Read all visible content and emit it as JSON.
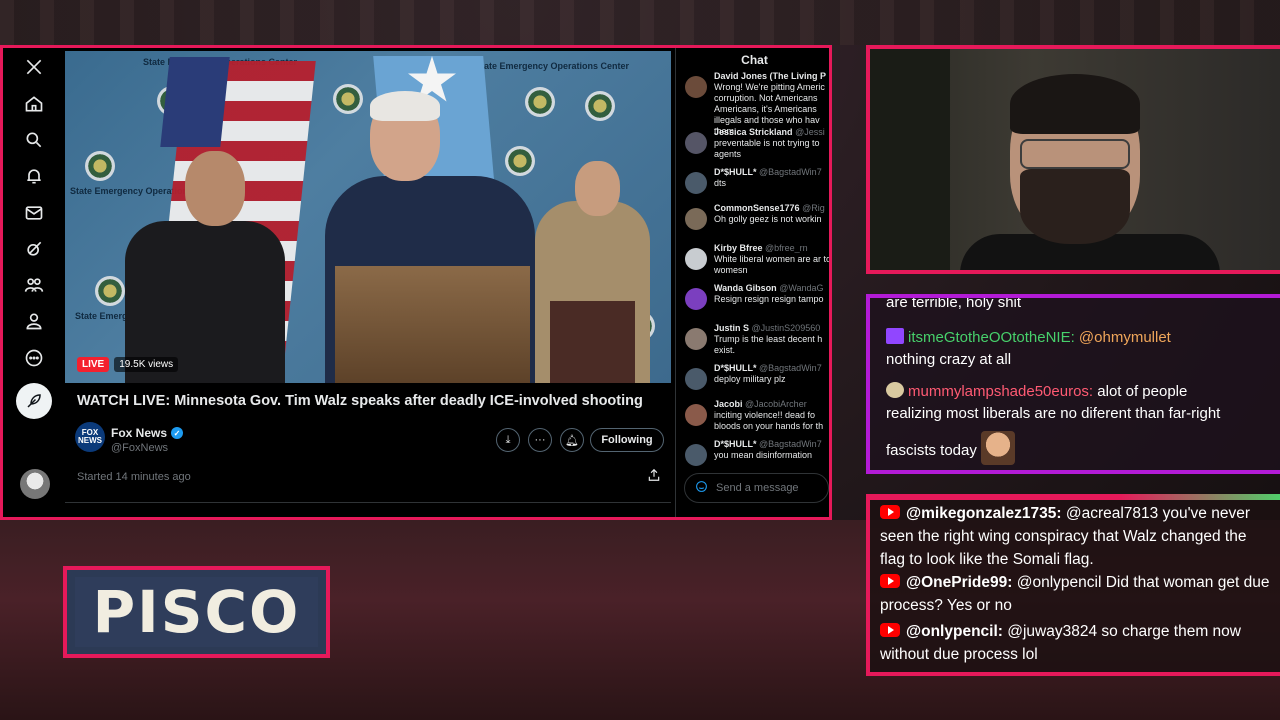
{
  "x_post": {
    "live_label": "LIVE",
    "views": "19.5K views",
    "title": "WATCH LIVE: Minnesota Gov. Tim Walz speaks after deadly ICE-involved shooting",
    "author_name": "Fox News",
    "author_handle": "@FoxNews",
    "author_avatar_text": "FOX NEWS",
    "follow_label": "Following",
    "started": "Started 14 minutes ago",
    "backdrop_text": "State Emergency Operations Center"
  },
  "nav": {
    "icons": [
      "x-logo-icon",
      "home-icon",
      "search-icon",
      "bell-icon",
      "mail-icon",
      "grok-icon",
      "communities-icon",
      "profile-icon",
      "more-icon"
    ]
  },
  "chat": {
    "title": "Chat",
    "send_placeholder": "Send a message",
    "messages": [
      {
        "user": "David Jones (The Living P",
        "handle": "",
        "text": "Wrong! We're pitting Americ corruption. Not Americans Americans, it's Americans illegals and those who hav them...",
        "color": "#6b4b3a"
      },
      {
        "user": "Jessica Strickland",
        "handle": "@Jessi",
        "text": "preventable is not trying to agents",
        "color": "#556"
      },
      {
        "user": "D*$HULL*",
        "handle": "@BagstadWin7",
        "text": "dts",
        "color": "#4a5a6a"
      },
      {
        "user": "CommonSense1776",
        "handle": "@Rig",
        "text": "Oh golly geez is not workin",
        "color": "#7a6a58"
      },
      {
        "user": "Kirby Bfree",
        "handle": "@bfree_rn",
        "text": "White liberal women are ar to womesn",
        "color": "#c8ccd0"
      },
      {
        "user": "Wanda Gibson",
        "handle": "@WandaG",
        "text": "Resign resign resign tampo",
        "color": "#7b3fbf"
      },
      {
        "user": "Justin S",
        "handle": "@JustinS209560",
        "text": "Trump is the least decent h exist.",
        "color": "#8a7a70"
      },
      {
        "user": "D*$HULL*",
        "handle": "@BagstadWin7",
        "text": "deploy military plz",
        "color": "#4a5a6a"
      },
      {
        "user": "Jacobi",
        "handle": "@JacobiArcher",
        "text": "inciting violence!! dead fo bloods on your hands for th",
        "color": "#8a5a4a"
      },
      {
        "user": "D*$HULL*",
        "handle": "@BagstadWin7",
        "text": "you mean disinformation",
        "color": "#4a5a6a"
      }
    ]
  },
  "twitch_chat": {
    "partial_line": "are terrible, holy shit",
    "msg1_user": "itsmeGtotheOOtotheNIE:",
    "msg1_mention": "@ohmymullet",
    "msg1_text": "nothing crazy at all",
    "msg2_user": "mummylampshade50euros:",
    "msg2_text_a": "alot of people",
    "msg2_text_b": "realizing most liberals are no diferent than far-right",
    "msg2_text_c": "fascists today"
  },
  "youtube_chat": {
    "messages": [
      {
        "user": "@mikegonzalez1735:",
        "text": "@acreal7813 you've never seen the right wing conspiracy that Walz changed the flag to look like the Somali flag."
      },
      {
        "user": "@OnePride99:",
        "text": "@onlypencil Did that woman get due process? Yes or no"
      },
      {
        "user": "@onlypencil:",
        "text": "@juway3824 so charge them now without due process lol"
      }
    ]
  },
  "logo": {
    "text": "PISCO"
  },
  "colors": {
    "frame_red": "#e6195a",
    "twitch_purple": "#b31bd6",
    "x_blue": "#1d9bf0"
  }
}
